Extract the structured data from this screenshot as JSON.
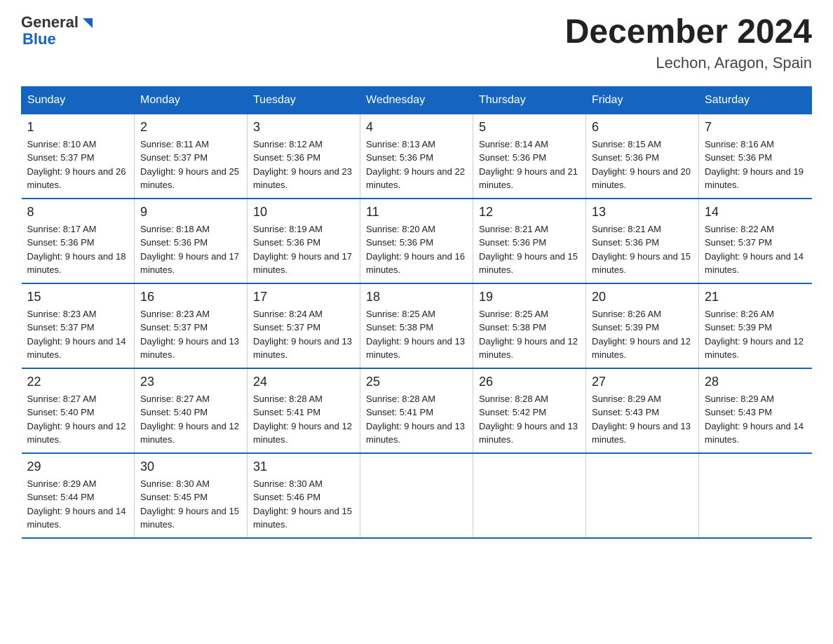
{
  "header": {
    "logo": {
      "general": "General",
      "blue": "Blue"
    },
    "title": "December 2024",
    "location": "Lechon, Aragon, Spain"
  },
  "days_of_week": [
    "Sunday",
    "Monday",
    "Tuesday",
    "Wednesday",
    "Thursday",
    "Friday",
    "Saturday"
  ],
  "weeks": [
    [
      {
        "day": "1",
        "sunrise": "8:10 AM",
        "sunset": "5:37 PM",
        "daylight": "9 hours and 26 minutes."
      },
      {
        "day": "2",
        "sunrise": "8:11 AM",
        "sunset": "5:37 PM",
        "daylight": "9 hours and 25 minutes."
      },
      {
        "day": "3",
        "sunrise": "8:12 AM",
        "sunset": "5:36 PM",
        "daylight": "9 hours and 23 minutes."
      },
      {
        "day": "4",
        "sunrise": "8:13 AM",
        "sunset": "5:36 PM",
        "daylight": "9 hours and 22 minutes."
      },
      {
        "day": "5",
        "sunrise": "8:14 AM",
        "sunset": "5:36 PM",
        "daylight": "9 hours and 21 minutes."
      },
      {
        "day": "6",
        "sunrise": "8:15 AM",
        "sunset": "5:36 PM",
        "daylight": "9 hours and 20 minutes."
      },
      {
        "day": "7",
        "sunrise": "8:16 AM",
        "sunset": "5:36 PM",
        "daylight": "9 hours and 19 minutes."
      }
    ],
    [
      {
        "day": "8",
        "sunrise": "8:17 AM",
        "sunset": "5:36 PM",
        "daylight": "9 hours and 18 minutes."
      },
      {
        "day": "9",
        "sunrise": "8:18 AM",
        "sunset": "5:36 PM",
        "daylight": "9 hours and 17 minutes."
      },
      {
        "day": "10",
        "sunrise": "8:19 AM",
        "sunset": "5:36 PM",
        "daylight": "9 hours and 17 minutes."
      },
      {
        "day": "11",
        "sunrise": "8:20 AM",
        "sunset": "5:36 PM",
        "daylight": "9 hours and 16 minutes."
      },
      {
        "day": "12",
        "sunrise": "8:21 AM",
        "sunset": "5:36 PM",
        "daylight": "9 hours and 15 minutes."
      },
      {
        "day": "13",
        "sunrise": "8:21 AM",
        "sunset": "5:36 PM",
        "daylight": "9 hours and 15 minutes."
      },
      {
        "day": "14",
        "sunrise": "8:22 AM",
        "sunset": "5:37 PM",
        "daylight": "9 hours and 14 minutes."
      }
    ],
    [
      {
        "day": "15",
        "sunrise": "8:23 AM",
        "sunset": "5:37 PM",
        "daylight": "9 hours and 14 minutes."
      },
      {
        "day": "16",
        "sunrise": "8:23 AM",
        "sunset": "5:37 PM",
        "daylight": "9 hours and 13 minutes."
      },
      {
        "day": "17",
        "sunrise": "8:24 AM",
        "sunset": "5:37 PM",
        "daylight": "9 hours and 13 minutes."
      },
      {
        "day": "18",
        "sunrise": "8:25 AM",
        "sunset": "5:38 PM",
        "daylight": "9 hours and 13 minutes."
      },
      {
        "day": "19",
        "sunrise": "8:25 AM",
        "sunset": "5:38 PM",
        "daylight": "9 hours and 12 minutes."
      },
      {
        "day": "20",
        "sunrise": "8:26 AM",
        "sunset": "5:39 PM",
        "daylight": "9 hours and 12 minutes."
      },
      {
        "day": "21",
        "sunrise": "8:26 AM",
        "sunset": "5:39 PM",
        "daylight": "9 hours and 12 minutes."
      }
    ],
    [
      {
        "day": "22",
        "sunrise": "8:27 AM",
        "sunset": "5:40 PM",
        "daylight": "9 hours and 12 minutes."
      },
      {
        "day": "23",
        "sunrise": "8:27 AM",
        "sunset": "5:40 PM",
        "daylight": "9 hours and 12 minutes."
      },
      {
        "day": "24",
        "sunrise": "8:28 AM",
        "sunset": "5:41 PM",
        "daylight": "9 hours and 12 minutes."
      },
      {
        "day": "25",
        "sunrise": "8:28 AM",
        "sunset": "5:41 PM",
        "daylight": "9 hours and 13 minutes."
      },
      {
        "day": "26",
        "sunrise": "8:28 AM",
        "sunset": "5:42 PM",
        "daylight": "9 hours and 13 minutes."
      },
      {
        "day": "27",
        "sunrise": "8:29 AM",
        "sunset": "5:43 PM",
        "daylight": "9 hours and 13 minutes."
      },
      {
        "day": "28",
        "sunrise": "8:29 AM",
        "sunset": "5:43 PM",
        "daylight": "9 hours and 14 minutes."
      }
    ],
    [
      {
        "day": "29",
        "sunrise": "8:29 AM",
        "sunset": "5:44 PM",
        "daylight": "9 hours and 14 minutes."
      },
      {
        "day": "30",
        "sunrise": "8:30 AM",
        "sunset": "5:45 PM",
        "daylight": "9 hours and 15 minutes."
      },
      {
        "day": "31",
        "sunrise": "8:30 AM",
        "sunset": "5:46 PM",
        "daylight": "9 hours and 15 minutes."
      },
      {
        "day": "",
        "sunrise": "",
        "sunset": "",
        "daylight": ""
      },
      {
        "day": "",
        "sunrise": "",
        "sunset": "",
        "daylight": ""
      },
      {
        "day": "",
        "sunrise": "",
        "sunset": "",
        "daylight": ""
      },
      {
        "day": "",
        "sunrise": "",
        "sunset": "",
        "daylight": ""
      }
    ]
  ]
}
